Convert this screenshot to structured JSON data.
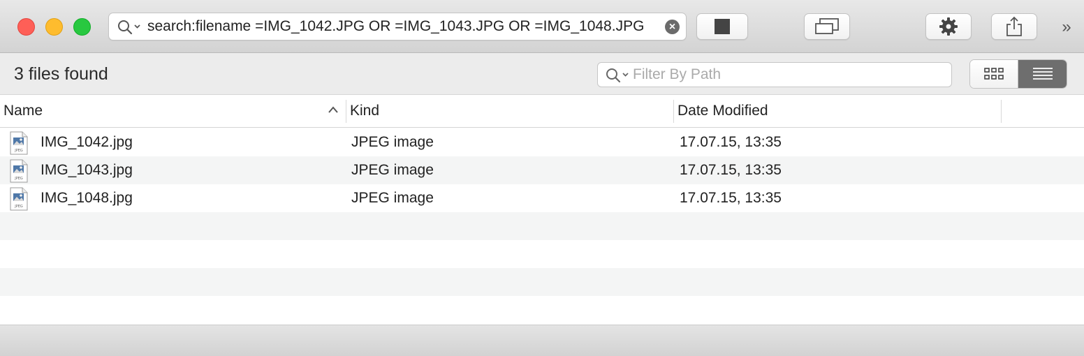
{
  "toolbar": {
    "search_query": "search:filename =IMG_1042.JPG OR =IMG_1043.JPG OR =IMG_1048.JPG",
    "clear_glyph": "×",
    "overflow_glyph": "»",
    "icons": [
      "search-icon",
      "chevron-down-icon",
      "clear-icon",
      "stop-icon",
      "window-icon",
      "gear-icon",
      "share-icon",
      "overflow-icon"
    ]
  },
  "filterbar": {
    "result_count": "3 files found",
    "filter_placeholder": "Filter By Path",
    "filter_value": "",
    "views": [
      "icon-view",
      "list-view"
    ],
    "selected_view": "list-view"
  },
  "table": {
    "columns": [
      {
        "label": "Name",
        "sort": "ascending"
      },
      {
        "label": "Kind"
      },
      {
        "label": "Date Modified"
      }
    ],
    "rows": [
      {
        "name": "IMG_1042.jpg",
        "kind": "JPEG image",
        "date": "17.07.15, 13:35"
      },
      {
        "name": "IMG_1043.jpg",
        "kind": "JPEG image",
        "date": "17.07.15, 13:35"
      },
      {
        "name": "IMG_1048.jpg",
        "kind": "JPEG image",
        "date": "17.07.15, 13:35"
      }
    ],
    "icon_badge": "JPEG"
  },
  "colors": {
    "close": "#fe5f57",
    "minimize": "#febc2e",
    "maximize": "#28c840",
    "selected_segment": "#6e6e6e"
  }
}
